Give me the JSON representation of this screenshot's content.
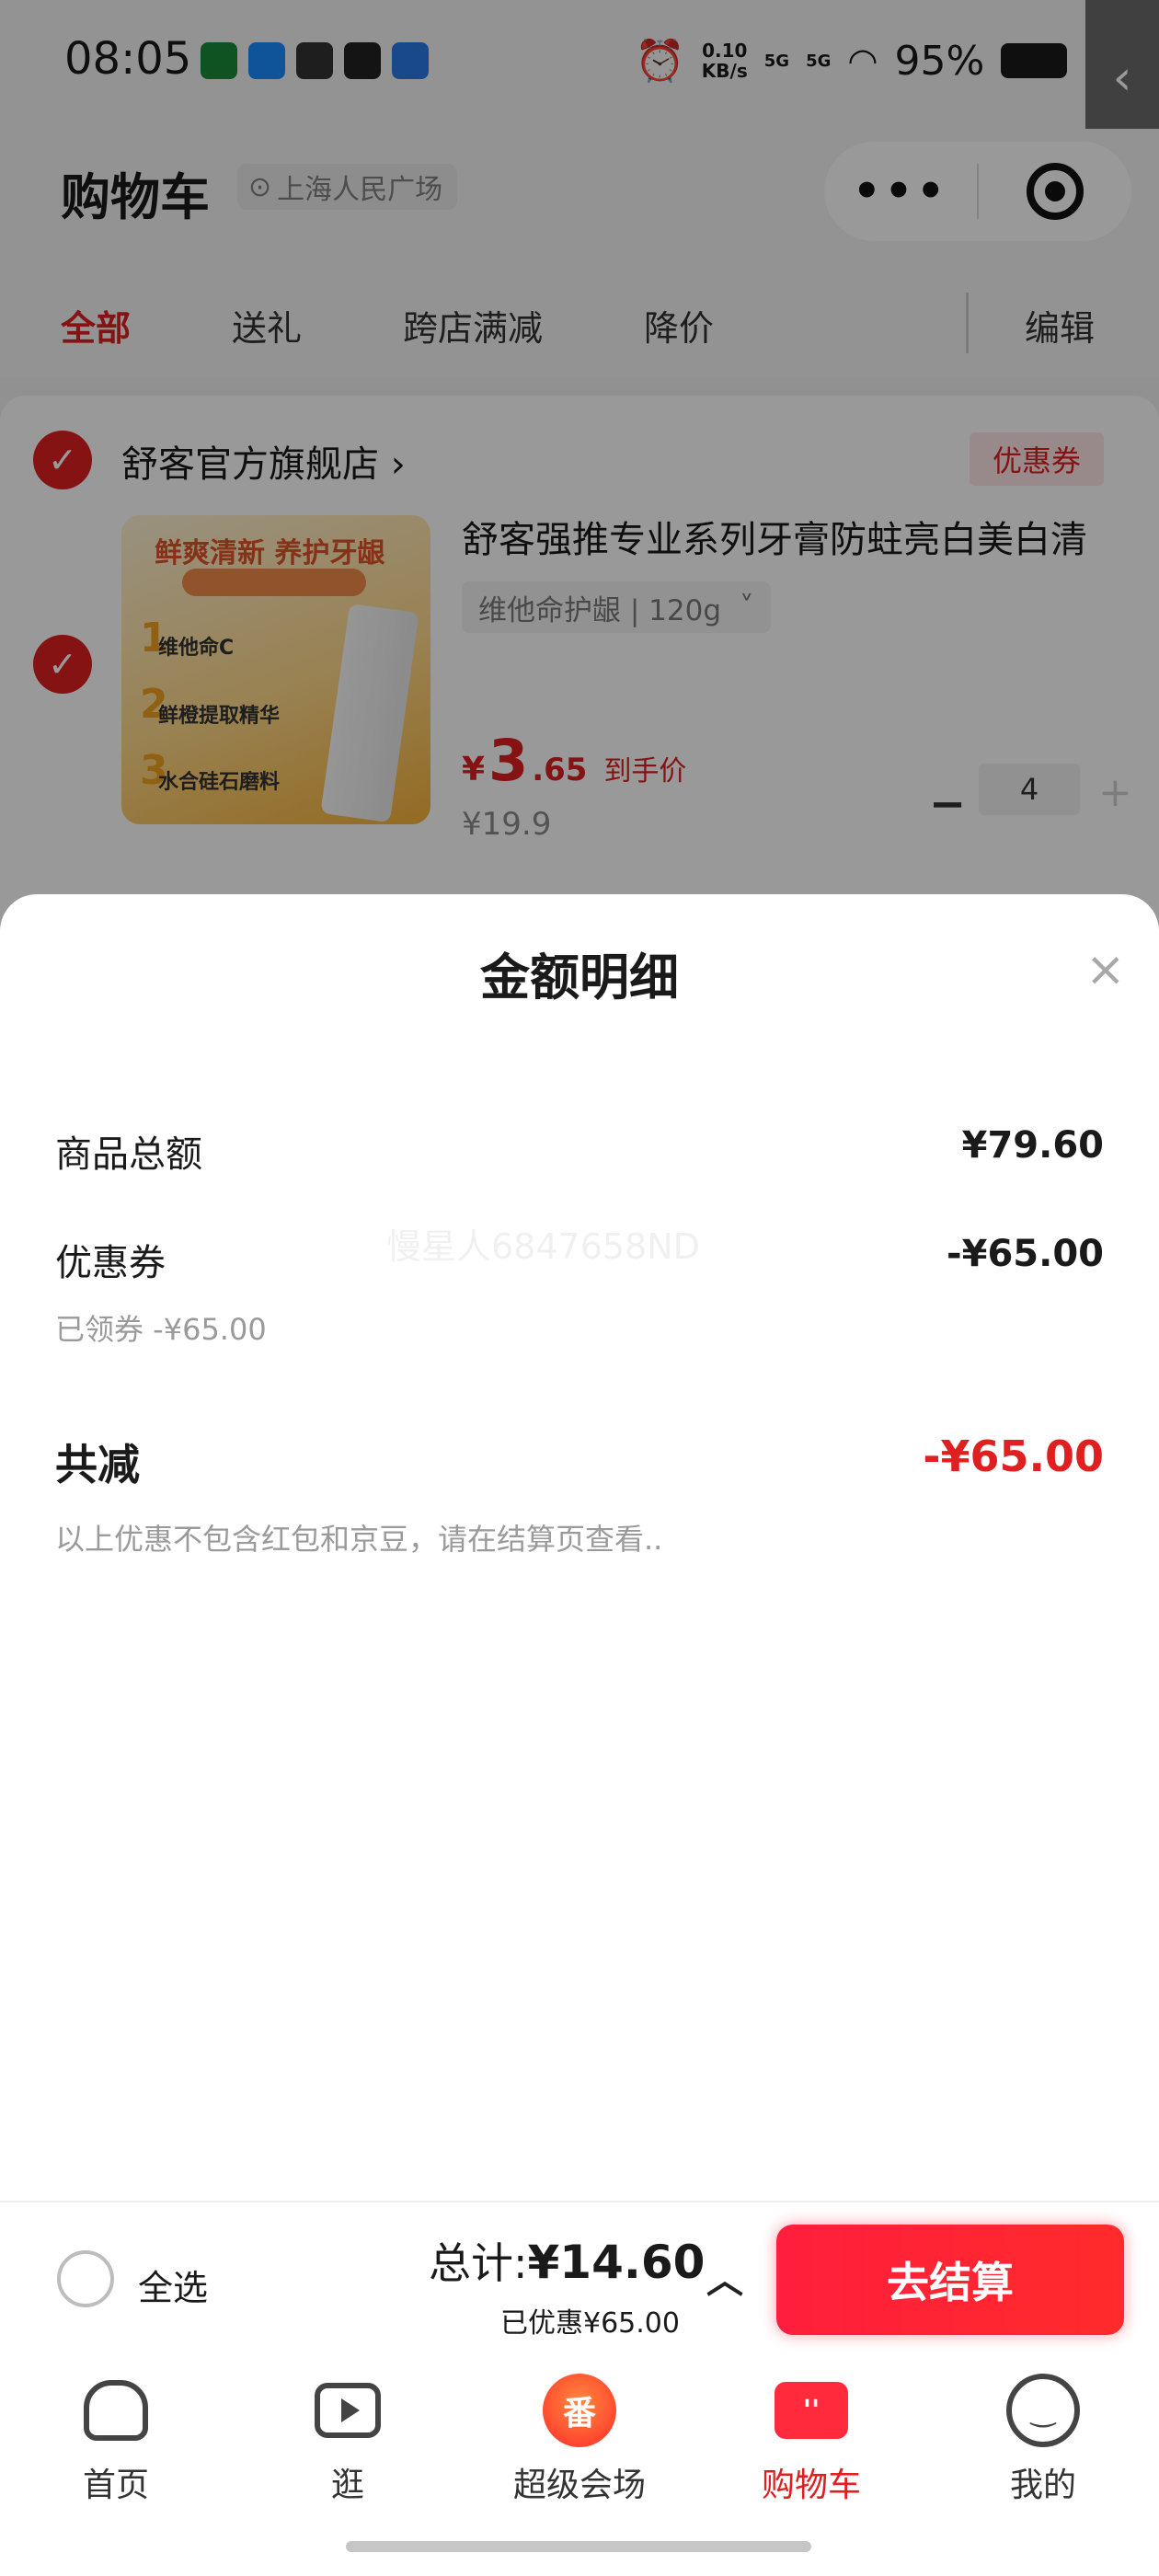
{
  "status_bar": {
    "time": "08:05",
    "net_speed_value": "0.10",
    "net_speed_unit": "KB/s",
    "signal1": "5G",
    "signal2": "5G",
    "battery": "95%",
    "icons": [
      "alarm-icon",
      "wifi-icon",
      "signal-icon",
      "battery-icon"
    ]
  },
  "header": {
    "title": "购物车",
    "location": "上海人民广场",
    "more_glyph": "•••",
    "edge_tab_glyph": "‹"
  },
  "tabs": [
    {
      "label": "全部",
      "active": true
    },
    {
      "label": "送礼"
    },
    {
      "label": "跨店满减"
    },
    {
      "label": "降价"
    }
  ],
  "edit_label": "编辑",
  "store": {
    "name": "舒客官方旗舰店",
    "name_chevron": "›",
    "coupon_tag": "优惠券",
    "check_glyph": "✓",
    "product": {
      "image_headline": "鲜爽清新 养护牙龈",
      "image_lines": [
        "维他命C",
        "鲜橙提取精华",
        "水合硅石磨料"
      ],
      "title": "舒客强推专业系列牙膏防蛀亮白美白清",
      "spec": "维他命护龈 | 120g",
      "spec_chevron": "˅",
      "price_symbol": "¥",
      "price_int": "3",
      "price_dec": ".65",
      "price_label": "到手价",
      "old_price": "¥19.9",
      "quantity": "4",
      "minus": "−",
      "plus": "+"
    }
  },
  "sheet": {
    "title": "金额明细",
    "close_glyph": "×",
    "rows": {
      "goods_total_label": "商品总额",
      "goods_total_value": "¥79.60",
      "coupon_label": "优惠券",
      "coupon_value": "-¥65.00",
      "coupon_note": "已领券 -¥65.00",
      "total_cut_label": "共减",
      "total_cut_value": "-¥65.00",
      "disclaimer": "以上优惠不包含红包和京豆，请在结算页查看.."
    },
    "watermark": "慢星人6847658ND"
  },
  "checkout_bar": {
    "select_all": "全选",
    "total_label": "总计:",
    "total_value": "¥14.60",
    "saved": "已优惠¥65.00",
    "expand_glyph": "︿",
    "button": "去结算"
  },
  "bottom_nav": [
    {
      "label": "首页",
      "icon": "home-icon"
    },
    {
      "label": "逛",
      "icon": "video-icon"
    },
    {
      "label": "超级会场",
      "icon": "flame-icon",
      "glyph": "番"
    },
    {
      "label": "购物车",
      "icon": "cart-icon",
      "active": true,
      "glyph": "''"
    },
    {
      "label": "我的",
      "icon": "smile-icon",
      "glyph": "‿"
    }
  ],
  "colors": {
    "accent_red": "#e02020",
    "button_red": "#ff1e3c",
    "overlay": "rgba(0,0,0,0.40)"
  }
}
